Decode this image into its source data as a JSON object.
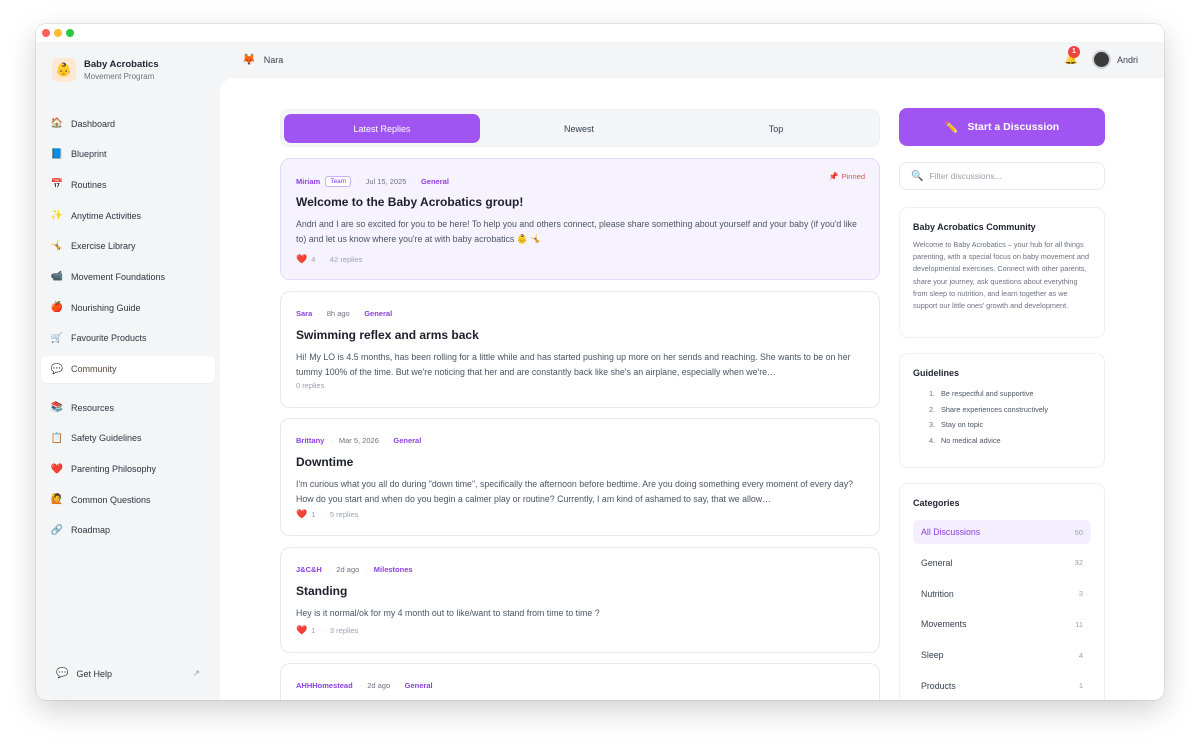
{
  "window": {
    "colors": {
      "accent": "#a055f3",
      "sidebar_bg": "#f4f5f7"
    }
  },
  "brand": {
    "name": "Baby Acrobatics",
    "subtitle": "Movement Program",
    "logo_icon": "baby-face"
  },
  "sidebar": {
    "items": [
      {
        "label": "Dashboard",
        "icon": "house",
        "glyph": "🏠"
      },
      {
        "label": "Blueprint",
        "icon": "book",
        "glyph": "📘"
      },
      {
        "label": "Routines",
        "icon": "calendar",
        "glyph": "📅"
      },
      {
        "label": "Anytime Activities",
        "icon": "sparkles",
        "glyph": "✨"
      },
      {
        "label": "Exercise Library",
        "icon": "cartwheel",
        "glyph": "🤸"
      },
      {
        "label": "Movement Foundations",
        "icon": "video-camera",
        "glyph": "📹"
      },
      {
        "label": "Nourishing Guide",
        "icon": "apple",
        "glyph": "🍎"
      },
      {
        "label": "Favourite Products",
        "icon": "cart",
        "glyph": "🛒"
      },
      {
        "label": "Community",
        "icon": "speech-bubble",
        "glyph": "💬",
        "active": true
      },
      {
        "label": "Resources",
        "icon": "books",
        "glyph": "📚"
      },
      {
        "label": "Safety Guidelines",
        "icon": "clipboard",
        "glyph": "📋"
      },
      {
        "label": "Parenting Philosophy",
        "icon": "heart",
        "glyph": "❤️"
      },
      {
        "label": "Common Questions",
        "icon": "person-raising-hand",
        "glyph": "🙋"
      },
      {
        "label": "Roadmap",
        "icon": "link",
        "glyph": "🔗"
      }
    ],
    "get_help": "Get Help"
  },
  "topbar": {
    "workspace": "Nara",
    "workspace_icon": "fox",
    "notifications": "1",
    "user": "Andri"
  },
  "tabs": [
    "Latest Replies",
    "Newest",
    "Top"
  ],
  "posts": [
    {
      "author": "Miriam",
      "badge": "Team",
      "date": "Jul 15, 2025",
      "category": "General",
      "pinned": "Pinned",
      "title": "Welcome to the Baby Acrobatics group!",
      "body": "Andri and I are so excited for you to be here! To help you and others connect, please share something about yourself and your baby (if you'd like to) and let us know where you're at with baby acrobatics 👶 🤸",
      "likes": "4",
      "replies": "42 replies"
    },
    {
      "author": "Sara",
      "date": "8h ago",
      "category": "General",
      "title": "Swimming reflex and arms back",
      "body": "Hi! My LO is 4.5 months, has been rolling for a little while and has started pushing up more on her sends and reaching. She wants to be on her tummy 100% of the time. But we're noticing that her and are constantly back like she's an airplane, especially when we're…",
      "replies": "0 replies"
    },
    {
      "author": "Brittany",
      "date": "Mar 5, 2026",
      "category": "General",
      "title": "Downtime",
      "body": "I'm curious what you all do during \"down time\", specifically the afternoon before bedtime. Are you doing something every moment of every day? How do you start and when do you begin a calmer play or routine? Currently, I am kind of ashamed to say, that we allow…",
      "likes": "1",
      "replies": "5 replies"
    },
    {
      "author": "J&C&H",
      "date": "2d ago",
      "category": "Milestones",
      "title": "Standing",
      "body": "Hey is it normal/ok for my 4 month out to like/want to stand from time to time ?",
      "likes": "1",
      "replies": "3 replies"
    },
    {
      "author": "AHHHomestead",
      "date": "2d ago",
      "category": "General"
    }
  ],
  "right": {
    "cta": "Start a Discussion",
    "cta_icon": "pencil",
    "filter_placeholder": "Filter discussions...",
    "about": {
      "title": "Baby Acrobatics Community",
      "text": "Welcome to Baby Acrobatics – your hub for all things parenting, with a special focus on baby movement and developmental exercises. Connect with other parents, share your journey, ask questions about everything from sleep to nutrition, and learn together as we support our little ones' growth and development."
    },
    "guidelines": {
      "title": "Guidelines",
      "items": [
        "Be respectful and supportive",
        "Share experiences constructively",
        "Stay on topic",
        "No medical advice"
      ]
    },
    "categories": {
      "title": "Categories",
      "items": [
        {
          "label": "All Discussions",
          "count": "50",
          "active": true
        },
        {
          "label": "General",
          "count": "32"
        },
        {
          "label": "Nutrition",
          "count": "3"
        },
        {
          "label": "Movements",
          "count": "11"
        },
        {
          "label": "Sleep",
          "count": "4"
        },
        {
          "label": "Products",
          "count": "1"
        }
      ]
    }
  }
}
